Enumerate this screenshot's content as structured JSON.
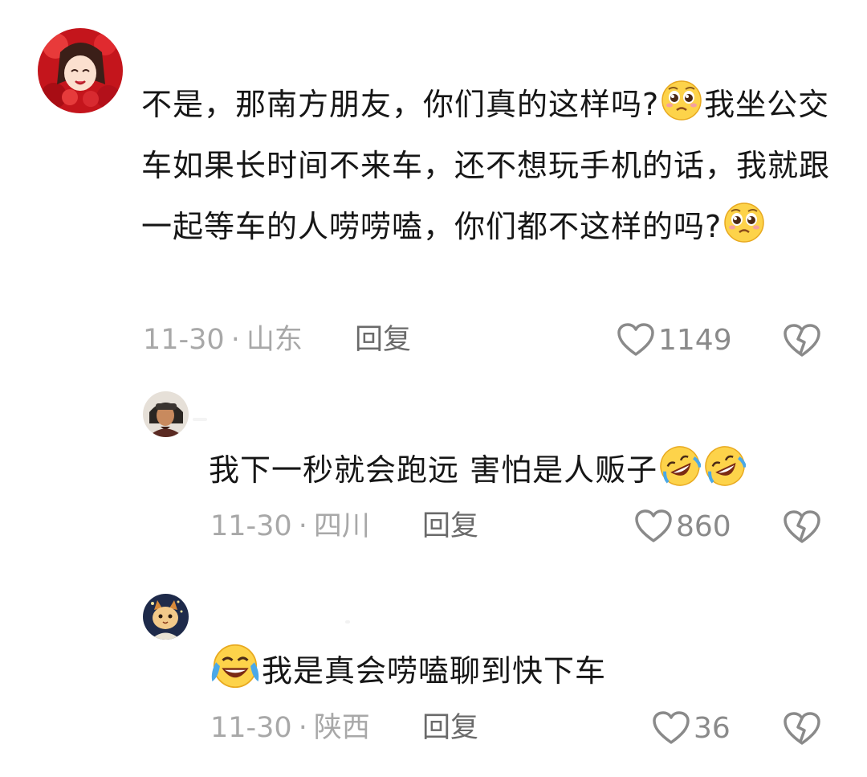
{
  "comments": [
    {
      "text_parts": [
        "不是，那南方朋友，你们真的这样吗?",
        "我坐公交车如果长时间不来车，还不想玩手机的话，我就跟一起等车的人唠唠嗑，你们都不这样的吗?"
      ],
      "emoji_name": "pleading-face-icon",
      "date": "11-30",
      "location": "山东",
      "reply_label": "回复",
      "likes": "1149"
    },
    {
      "text": "我下一秒就会跑远 害怕是人贩子",
      "emoji_name": "rolling-laughing-icon",
      "date": "11-30",
      "location": "四川",
      "reply_label": "回复",
      "likes": "860"
    },
    {
      "text": "我是真会唠嗑聊到快下车",
      "emoji_name": "tears-of-joy-icon",
      "date": "11-30",
      "location": "陕西",
      "reply_label": "回复",
      "likes": "36"
    }
  ],
  "meta_separator": "·",
  "colors": {
    "text": "#161616",
    "meta": "#a8a8a8",
    "reply": "#6a6a6a",
    "icon": "#8a8a8a"
  }
}
